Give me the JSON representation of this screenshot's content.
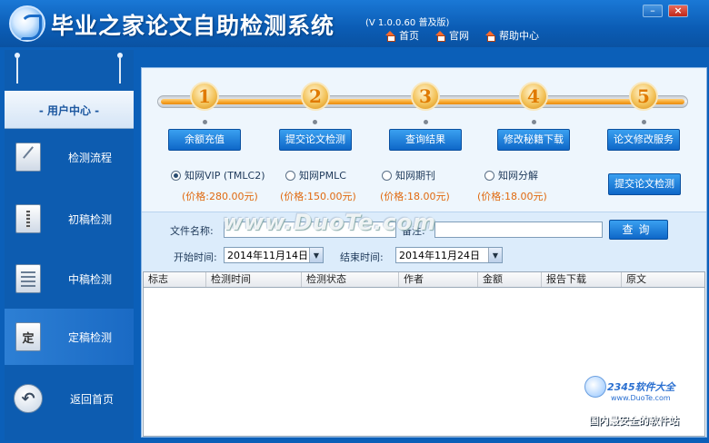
{
  "app": {
    "title": "毕业之家论文自助检测系统",
    "version": "(V 1.0.0.60 普及版)",
    "nav": [
      {
        "label": "首页",
        "icon": "home-icon"
      },
      {
        "label": "官网",
        "icon": "home-icon"
      },
      {
        "label": "帮助中心",
        "icon": "home-icon"
      }
    ],
    "window_buttons": {
      "minimize": "–",
      "close": "×"
    }
  },
  "sidebar": {
    "header": "- 用户中心 -",
    "items": [
      {
        "label": "检测流程",
        "icon": "pencil-document-icon",
        "active": false
      },
      {
        "label": "初稿检测",
        "icon": "zipper-document-icon",
        "active": false
      },
      {
        "label": "中稿检测",
        "icon": "text-document-icon",
        "active": false
      },
      {
        "label": "定稿检测",
        "icon": "final-document-icon",
        "icon_text": "定",
        "active": true
      },
      {
        "label": "返回首页",
        "icon": "back-arrow-icon",
        "active": false
      }
    ]
  },
  "steps": [
    {
      "number": "1",
      "label": "余额充值"
    },
    {
      "number": "2",
      "label": "提交论文检测"
    },
    {
      "number": "3",
      "label": "查询结果"
    },
    {
      "number": "4",
      "label": "修改秘籍下载"
    },
    {
      "number": "5",
      "label": "论文修改服务"
    }
  ],
  "options": [
    {
      "label": "知网VIP (TMLC2)",
      "price": "(价格:280.00元)",
      "selected": true
    },
    {
      "label": "知网PMLC",
      "price": "(价格:150.00元)",
      "selected": false
    },
    {
      "label": "知网期刊",
      "price": "(价格:18.00元)",
      "selected": false
    },
    {
      "label": "知网分解",
      "price": "(价格:18.00元)",
      "selected": false
    }
  ],
  "submit_button": "提交论文检测",
  "search": {
    "file_name_label": "文件名称:",
    "file_name_value": "",
    "remark_label": "备注:",
    "remark_value": "",
    "query_button": "查询",
    "start_label": "开始时间:",
    "start_value": "2014年11月14日",
    "end_label": "结束时间:",
    "end_value": "2014年11月24日"
  },
  "table": {
    "columns": [
      "标志",
      "检测时间",
      "检测状态",
      "作者",
      "金额",
      "报告下载",
      "原文"
    ],
    "rows": []
  },
  "watermarks": {
    "center": "www.DuoTe.com",
    "corner_brand": "2345软件大全",
    "corner_site": "www.DuoTe.com",
    "bottom": "国内最安全的软件站"
  },
  "colors": {
    "accent_blue": "#0e67c8",
    "step_orange": "#f6a326",
    "price_orange": "#e06a10"
  }
}
